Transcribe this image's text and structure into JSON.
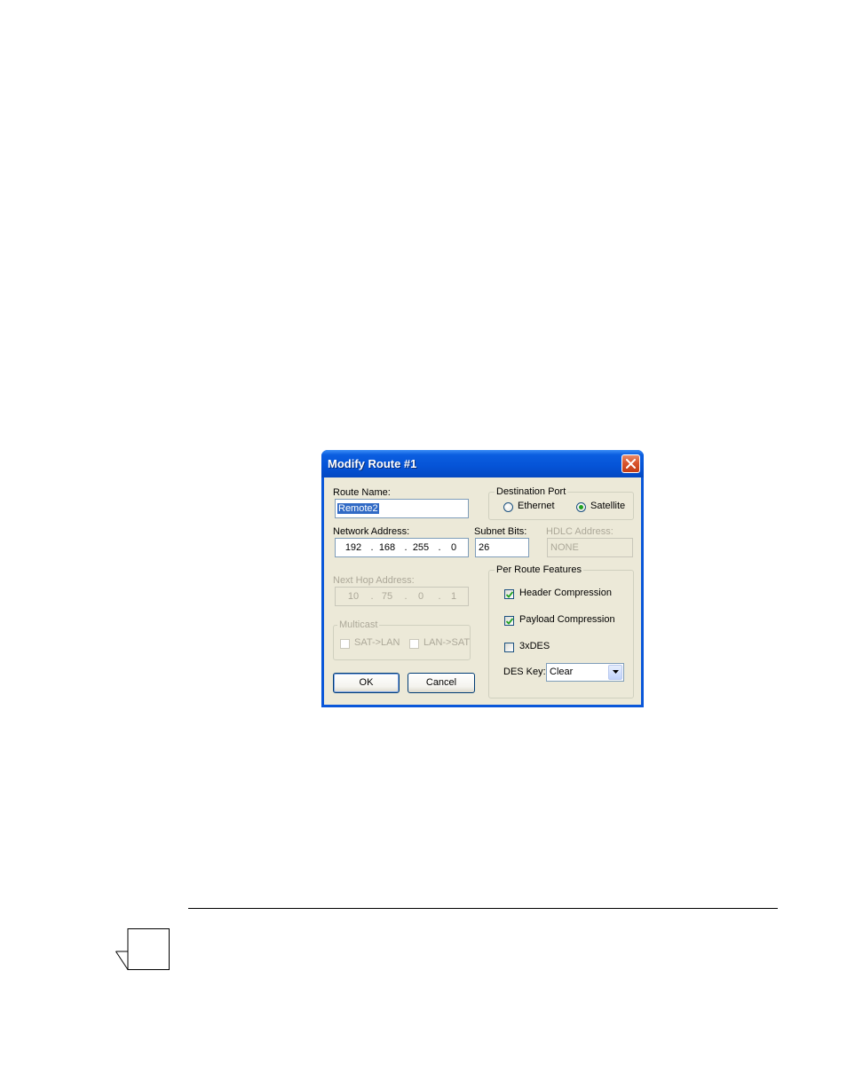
{
  "dialog": {
    "title": "Modify Route #1",
    "route_name_label": "Route Name:",
    "route_name_value": "Remote2",
    "destination_port": {
      "label": "Destination Port",
      "options": [
        "Ethernet",
        "Satellite"
      ],
      "selected": "Satellite"
    },
    "network_address_label": "Network Address:",
    "network_address": [
      "192",
      "168",
      "255",
      "0"
    ],
    "subnet_bits_label": "Subnet Bits:",
    "subnet_bits_value": "26",
    "hdlc_address_label": "HDLC Address:",
    "hdlc_address_value": "NONE",
    "next_hop_label": "Next Hop Address:",
    "next_hop_address": [
      "10",
      "75",
      "0",
      "1"
    ],
    "multicast": {
      "label": "Multicast",
      "sat_to_lan": "SAT->LAN",
      "lan_to_sat": "LAN->SAT"
    },
    "features": {
      "label": "Per Route Features",
      "header_compression": {
        "label": "Header Compression",
        "checked": true
      },
      "payload_compression": {
        "label": "Payload Compression",
        "checked": true
      },
      "triple_des": {
        "label": "3xDES",
        "checked": false
      }
    },
    "des_key_label": "DES Key:",
    "des_key_value": "Clear",
    "ok_label": "OK",
    "cancel_label": "Cancel",
    "colors": {
      "title_bar": "#0553d6",
      "dialog_face": "#ece9d8",
      "selection": "#316ac5",
      "close_button": "#d9552d"
    }
  }
}
